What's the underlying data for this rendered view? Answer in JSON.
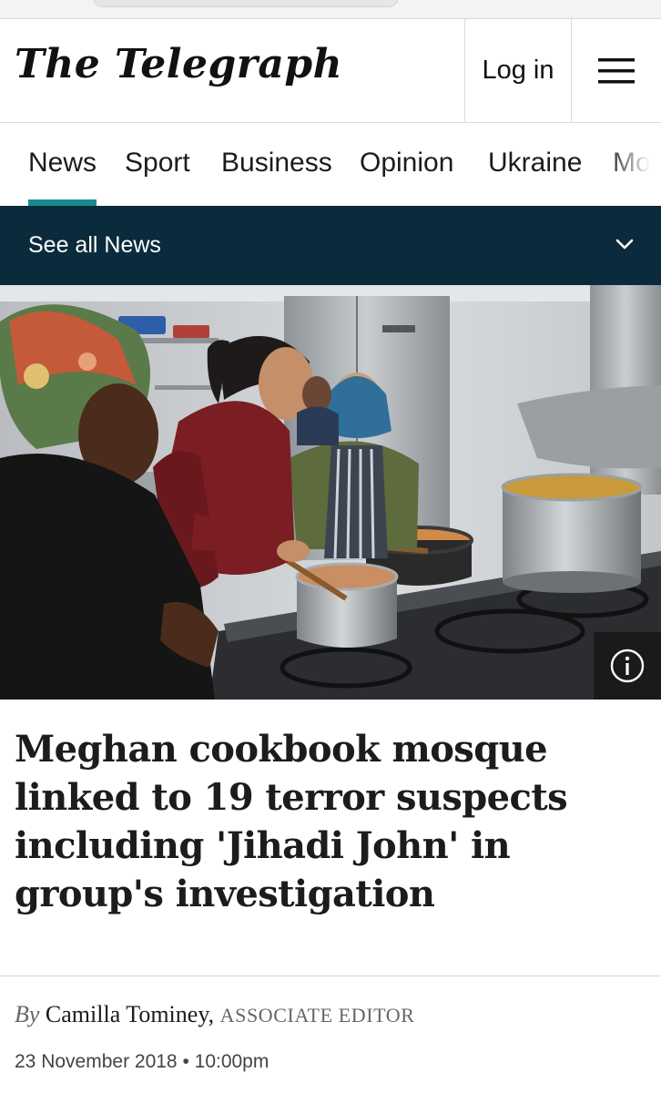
{
  "masthead": {
    "logo_text": "The Telegraph",
    "login_label": "Log in",
    "menu_icon": "hamburger-menu-icon"
  },
  "nav": {
    "items": [
      {
        "label": "News",
        "active": true
      },
      {
        "label": "Sport"
      },
      {
        "label": "Business"
      },
      {
        "label": "Opinion"
      },
      {
        "label": "Ukraine"
      },
      {
        "label": "Mo"
      }
    ],
    "accent_color": "#1b8a8c"
  },
  "subnav": {
    "label": "See all News",
    "icon": "chevron-down-icon",
    "background": "#0b2b3c"
  },
  "hero": {
    "info_icon": "info-icon"
  },
  "article": {
    "headline": "Meghan cookbook mosque linked to 19 terror suspects including 'Jihadi John' in group's investigation",
    "byline_prefix": "By",
    "author": "Camilla Tominey,",
    "author_role": "Associate Editor",
    "date": "23 November 2018 • 10:00pm"
  }
}
